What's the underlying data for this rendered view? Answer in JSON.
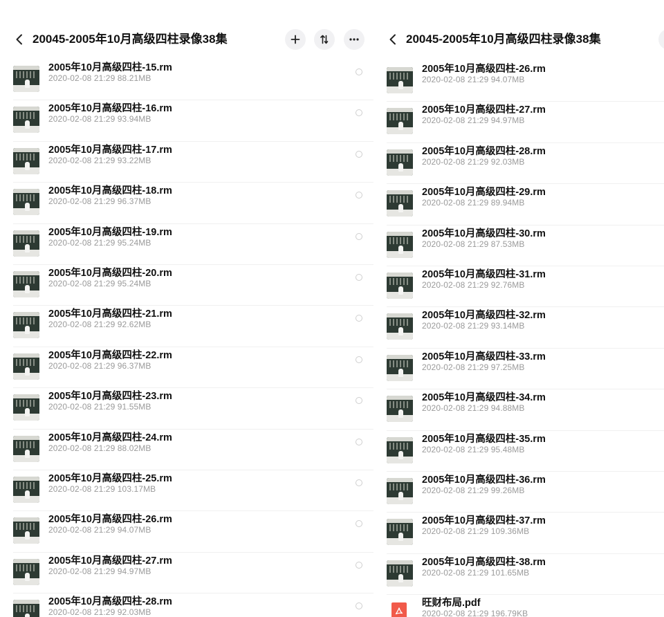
{
  "left": {
    "title": "20045-2005年10月高级四柱录像38集",
    "items": [
      {
        "name": "2005年10月高级四柱-15.rm",
        "date": "2020-02-08",
        "time": "21:29",
        "size": "88.21MB"
      },
      {
        "name": "2005年10月高级四柱-16.rm",
        "date": "2020-02-08",
        "time": "21:29",
        "size": "93.94MB"
      },
      {
        "name": "2005年10月高级四柱-17.rm",
        "date": "2020-02-08",
        "time": "21:29",
        "size": "93.22MB"
      },
      {
        "name": "2005年10月高级四柱-18.rm",
        "date": "2020-02-08",
        "time": "21:29",
        "size": "96.37MB"
      },
      {
        "name": "2005年10月高级四柱-19.rm",
        "date": "2020-02-08",
        "time": "21:29",
        "size": "95.24MB"
      },
      {
        "name": "2005年10月高级四柱-20.rm",
        "date": "2020-02-08",
        "time": "21:29",
        "size": "95.24MB"
      },
      {
        "name": "2005年10月高级四柱-21.rm",
        "date": "2020-02-08",
        "time": "21:29",
        "size": "92.62MB"
      },
      {
        "name": "2005年10月高级四柱-22.rm",
        "date": "2020-02-08",
        "time": "21:29",
        "size": "96.37MB"
      },
      {
        "name": "2005年10月高级四柱-23.rm",
        "date": "2020-02-08",
        "time": "21:29",
        "size": "91.55MB"
      },
      {
        "name": "2005年10月高级四柱-24.rm",
        "date": "2020-02-08",
        "time": "21:29",
        "size": "88.02MB"
      },
      {
        "name": "2005年10月高级四柱-25.rm",
        "date": "2020-02-08",
        "time": "21:29",
        "size": "103.17MB"
      },
      {
        "name": "2005年10月高级四柱-26.rm",
        "date": "2020-02-08",
        "time": "21:29",
        "size": "94.07MB"
      },
      {
        "name": "2005年10月高级四柱-27.rm",
        "date": "2020-02-08",
        "time": "21:29",
        "size": "94.97MB"
      },
      {
        "name": "2005年10月高级四柱-28.rm",
        "date": "2020-02-08",
        "time": "21:29",
        "size": "92.03MB"
      }
    ]
  },
  "right": {
    "title": "20045-2005年10月高级四柱录像38集",
    "items": [
      {
        "name": "2005年10月高级四柱-26.rm",
        "date": "2020-02-08",
        "time": "21:29",
        "size": "94.07MB"
      },
      {
        "name": "2005年10月高级四柱-27.rm",
        "date": "2020-02-08",
        "time": "21:29",
        "size": "94.97MB"
      },
      {
        "name": "2005年10月高级四柱-28.rm",
        "date": "2020-02-08",
        "time": "21:29",
        "size": "92.03MB"
      },
      {
        "name": "2005年10月高级四柱-29.rm",
        "date": "2020-02-08",
        "time": "21:29",
        "size": "89.94MB"
      },
      {
        "name": "2005年10月高级四柱-30.rm",
        "date": "2020-02-08",
        "time": "21:29",
        "size": "87.53MB"
      },
      {
        "name": "2005年10月高级四柱-31.rm",
        "date": "2020-02-08",
        "time": "21:29",
        "size": "92.76MB"
      },
      {
        "name": "2005年10月高级四柱-32.rm",
        "date": "2020-02-08",
        "time": "21:29",
        "size": "93.14MB"
      },
      {
        "name": "2005年10月高级四柱-33.rm",
        "date": "2020-02-08",
        "time": "21:29",
        "size": "97.25MB"
      },
      {
        "name": "2005年10月高级四柱-34.rm",
        "date": "2020-02-08",
        "time": "21:29",
        "size": "94.88MB"
      },
      {
        "name": "2005年10月高级四柱-35.rm",
        "date": "2020-02-08",
        "time": "21:29",
        "size": "95.48MB"
      },
      {
        "name": "2005年10月高级四柱-36.rm",
        "date": "2020-02-08",
        "time": "21:29",
        "size": "99.26MB"
      },
      {
        "name": "2005年10月高级四柱-37.rm",
        "date": "2020-02-08",
        "time": "21:29",
        "size": "109.36MB"
      },
      {
        "name": "2005年10月高级四柱-38.rm",
        "date": "2020-02-08",
        "time": "21:29",
        "size": "101.65MB"
      },
      {
        "name": "旺财布局.pdf",
        "date": "2020-02-08",
        "time": "21:29",
        "size": "196.79KB",
        "kind": "pdf"
      }
    ]
  },
  "icons": {
    "back": "chevron-left-icon",
    "add": "plus-icon",
    "sort": "sort-icon",
    "more": "more-horizontal-icon",
    "video": "video-thumbnail-icon",
    "pdf": "pdf-icon"
  },
  "colors": {
    "pdf_accent": "#f15a4a",
    "meta_text": "#9a9a9a",
    "button_bg": "#f1f1f3"
  }
}
